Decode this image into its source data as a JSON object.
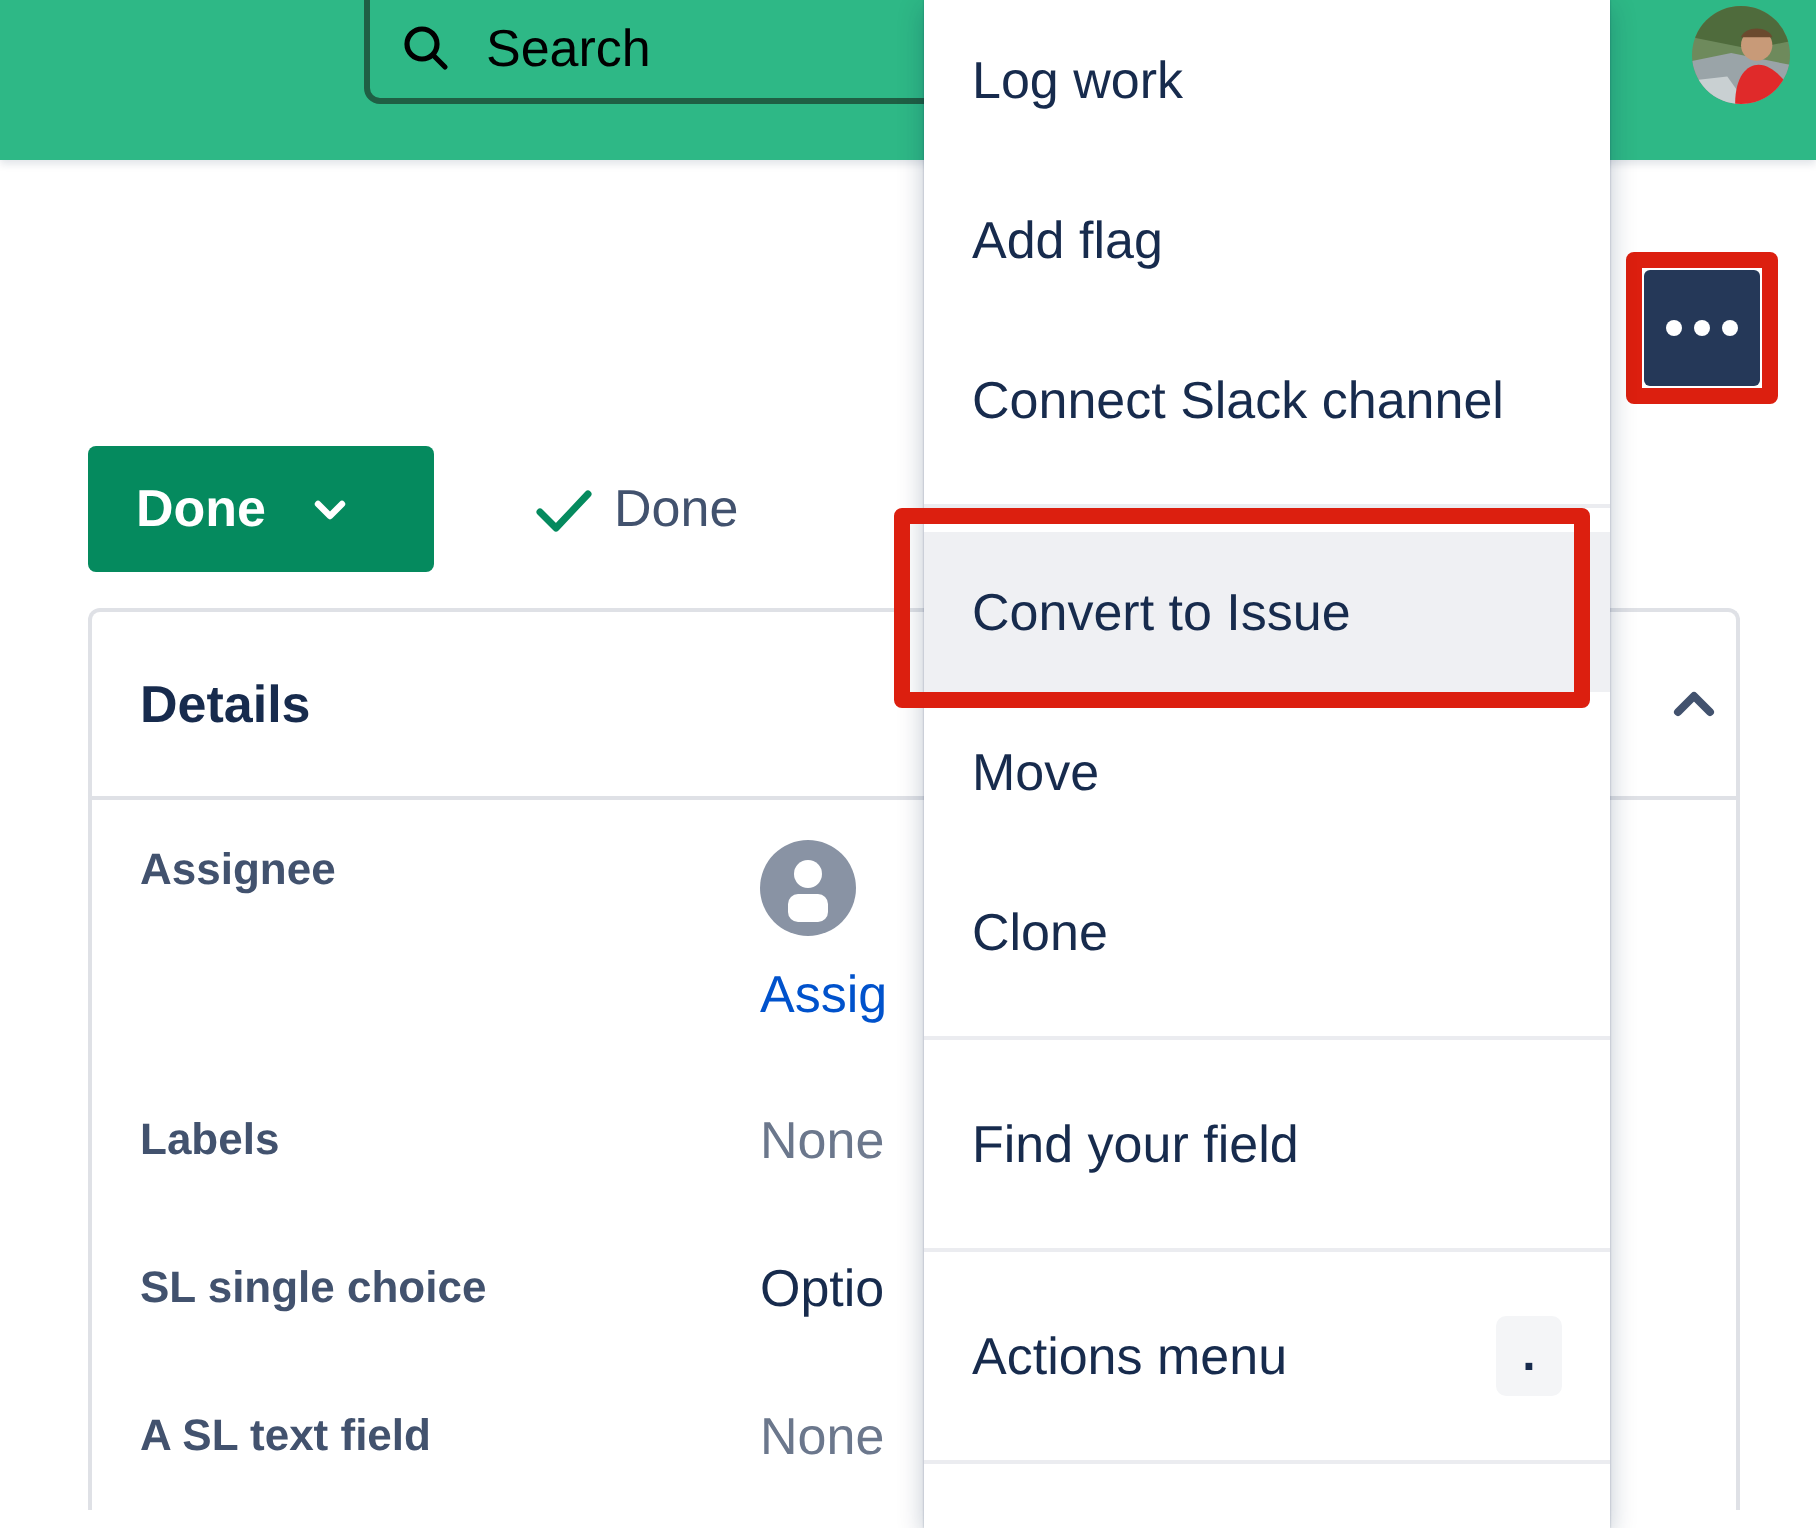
{
  "header": {
    "search": {
      "placeholder": "Search"
    }
  },
  "more_button": {
    "highlighted": true
  },
  "status_button": {
    "label": "Done"
  },
  "resolution": {
    "label": "Done"
  },
  "details": {
    "title": "Details",
    "expanded": true,
    "fields": [
      {
        "kind": "user",
        "label": "Assignee",
        "link": "Assig"
      },
      {
        "kind": "text",
        "label": "Labels",
        "value": "None",
        "empty": true
      },
      {
        "kind": "text",
        "label": "SL single choice",
        "value": "Optio",
        "empty": false
      },
      {
        "kind": "text",
        "label": "A SL text field",
        "value": "None",
        "empty": true
      }
    ]
  },
  "menu": {
    "groups": [
      [
        {
          "label": "Log work",
          "selected": false
        },
        {
          "label": "Add flag",
          "selected": false
        },
        {
          "label": "Connect Slack channel",
          "selected": false
        }
      ],
      [
        {
          "label": "Convert to Issue",
          "selected": true,
          "highlighted": true
        },
        {
          "label": "Move",
          "selected": false
        },
        {
          "label": "Clone",
          "selected": false
        }
      ],
      [
        {
          "label": "Find your field",
          "selected": false
        }
      ],
      [
        {
          "label": "Actions menu",
          "selected": false,
          "shortcut": "."
        }
      ]
    ]
  }
}
